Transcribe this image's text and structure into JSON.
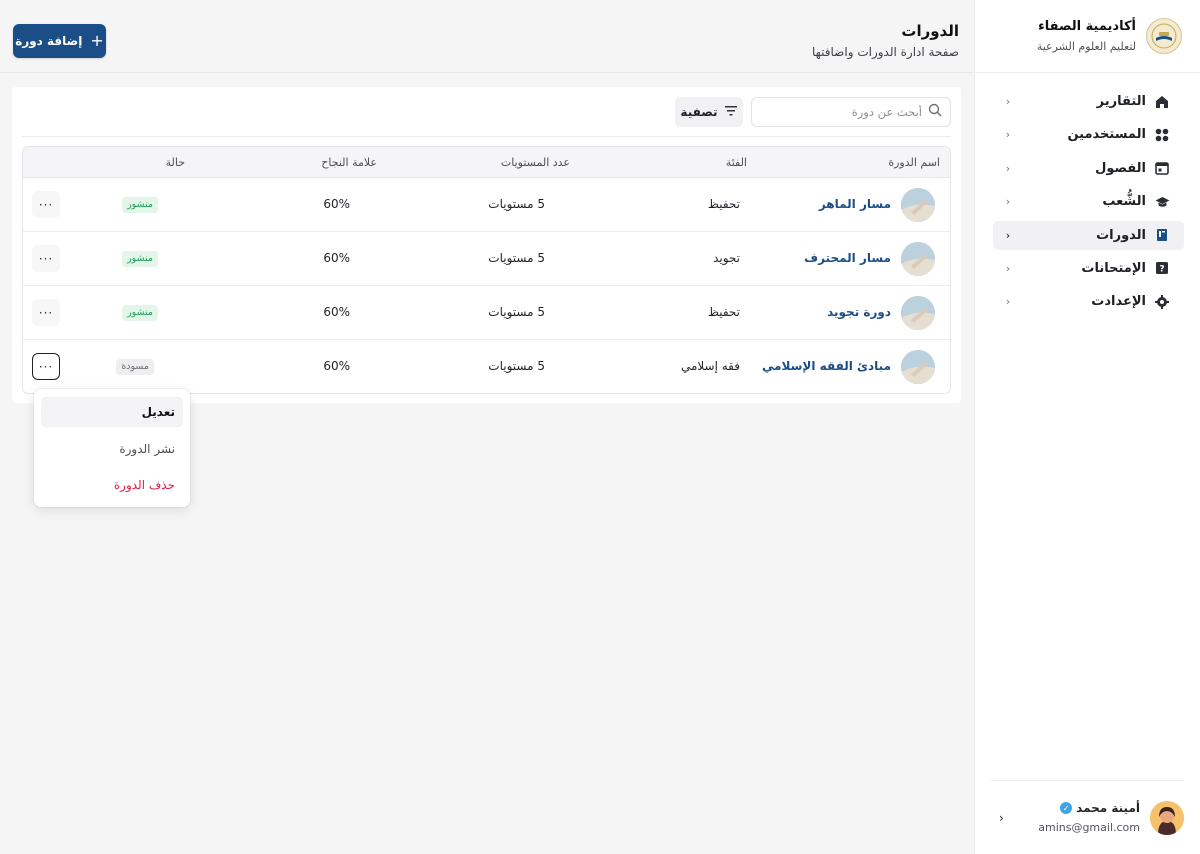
{
  "brand": {
    "name": "أكاديمية الصفاء",
    "subtitle": "لتعليم العلوم الشرعية"
  },
  "nav": {
    "items": [
      {
        "label": "التقارير",
        "icon": "home-icon"
      },
      {
        "label": "المستخدمين",
        "icon": "users-grid-icon"
      },
      {
        "label": "الفصول",
        "icon": "calendar-icon"
      },
      {
        "label": "الشُّعب",
        "icon": "graduation-cap-icon"
      },
      {
        "label": "الدورات",
        "icon": "book-icon",
        "active": true
      },
      {
        "label": "الإمتحانات",
        "icon": "exam-icon"
      },
      {
        "label": "الإعدادت",
        "icon": "settings-icon"
      }
    ]
  },
  "user": {
    "name": "أمينة محمد",
    "email": "amins@gmail.com"
  },
  "header": {
    "title": "الدورات",
    "subtitle": "صفحة ادارة الدورات واضافتها",
    "add_button": "إضافة دورة"
  },
  "toolbar": {
    "search_placeholder": "أبحث عن دورة",
    "filter_label": "تصفية"
  },
  "table": {
    "columns": [
      "اسم الدورة",
      "الفئة",
      "عدد المستويات",
      "علامة النجاح",
      "حالة"
    ],
    "rows": [
      {
        "name": "مسار الماهر",
        "category": "تحفيظ",
        "levels": "5 مستويات",
        "pass_mark": "60%",
        "status": "منشور",
        "status_type": "published"
      },
      {
        "name": "مسار المحترف",
        "category": "تجويد",
        "levels": "5 مستويات",
        "pass_mark": "60%",
        "status": "منشور",
        "status_type": "published"
      },
      {
        "name": "دورة تجويد",
        "category": "تحفيظ",
        "levels": "5 مستويات",
        "pass_mark": "60%",
        "status": "منشور",
        "status_type": "published"
      },
      {
        "name": "مبادئ الفقه الإسلامي",
        "category": "فقه إسلامي",
        "levels": "5 مستويات",
        "pass_mark": "60%",
        "status": "مسودة",
        "status_type": "draft"
      }
    ],
    "more_label": "···"
  },
  "row_menu": {
    "items": [
      {
        "label": "تعديل"
      },
      {
        "label": "نشر الدورة"
      },
      {
        "label": "حذف الدورة"
      }
    ]
  },
  "colors": {
    "primary": "#1b4d86",
    "published_bg": "#e4f6ea",
    "published_text": "#1f9d55",
    "draft_bg": "#eeeef0",
    "danger": "#e11d48"
  }
}
